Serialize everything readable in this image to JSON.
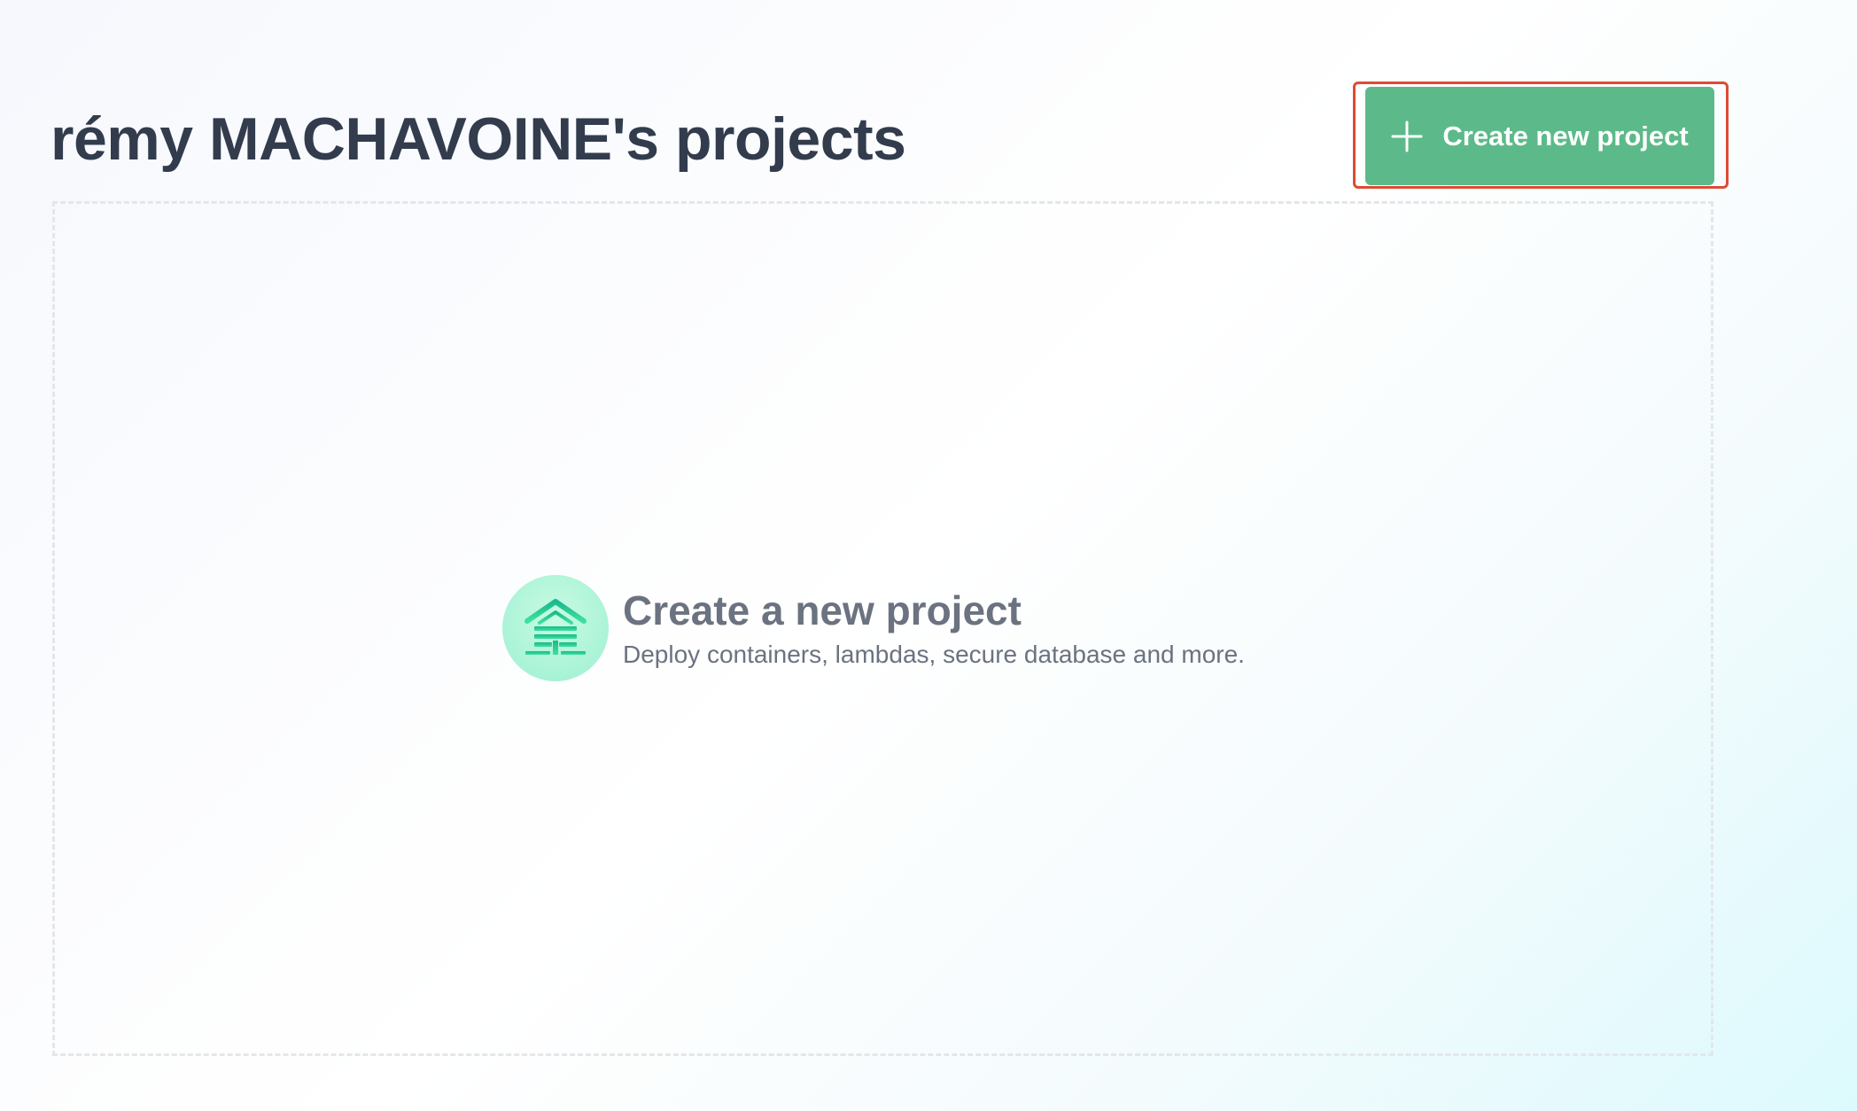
{
  "header": {
    "title": "rémy MACHAVOINE's projects",
    "create_button_label": "Create new project",
    "create_button_icon": "plus-icon"
  },
  "empty_state": {
    "icon": "house-icon",
    "title": "Create a new project",
    "subtitle": "Deploy containers, lambdas, secure database and more."
  },
  "colors": {
    "accent": "#5cba8a",
    "highlight": "#de4b34",
    "title_text": "#323c4d",
    "muted_text": "#6b7280",
    "icon_green": "#1fc792"
  }
}
